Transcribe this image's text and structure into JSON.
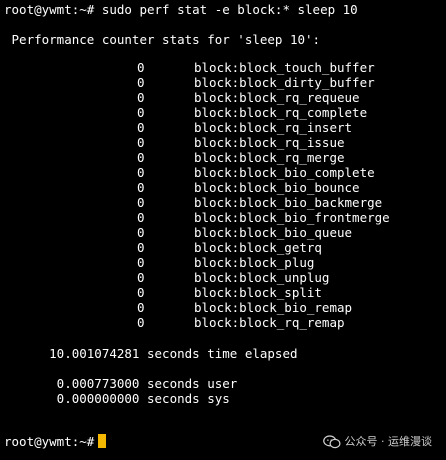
{
  "prompt": {
    "user_host": "root@ywmt:~#",
    "command": " sudo perf stat -e block:* sleep 10"
  },
  "header_text": " Performance counter stats for 'sleep 10':",
  "counters": [
    {
      "count": "0",
      "event": "block:block_touch_buffer"
    },
    {
      "count": "0",
      "event": "block:block_dirty_buffer"
    },
    {
      "count": "0",
      "event": "block:block_rq_requeue"
    },
    {
      "count": "0",
      "event": "block:block_rq_complete"
    },
    {
      "count": "0",
      "event": "block:block_rq_insert"
    },
    {
      "count": "0",
      "event": "block:block_rq_issue"
    },
    {
      "count": "0",
      "event": "block:block_rq_merge"
    },
    {
      "count": "0",
      "event": "block:block_bio_complete"
    },
    {
      "count": "0",
      "event": "block:block_bio_bounce"
    },
    {
      "count": "0",
      "event": "block:block_bio_backmerge"
    },
    {
      "count": "0",
      "event": "block:block_bio_frontmerge"
    },
    {
      "count": "0",
      "event": "block:block_bio_queue"
    },
    {
      "count": "0",
      "event": "block:block_getrq"
    },
    {
      "count": "0",
      "event": "block:block_plug"
    },
    {
      "count": "0",
      "event": "block:block_unplug"
    },
    {
      "count": "0",
      "event": "block:block_split"
    },
    {
      "count": "0",
      "event": "block:block_bio_remap"
    },
    {
      "count": "0",
      "event": "block:block_rq_remap"
    }
  ],
  "elapsed_text": "      10.001074281 seconds time elapsed",
  "user_text": "       0.000773000 seconds user",
  "sys_text": "       0.000000000 seconds sys",
  "final_prompt": "root@ywmt:~#",
  "watermark": {
    "icon": "wechat-icon",
    "label": "公众号 · 运维漫谈"
  },
  "colors": {
    "background": "#000000",
    "text": "#ffffff",
    "cursor": "#f5b800"
  }
}
